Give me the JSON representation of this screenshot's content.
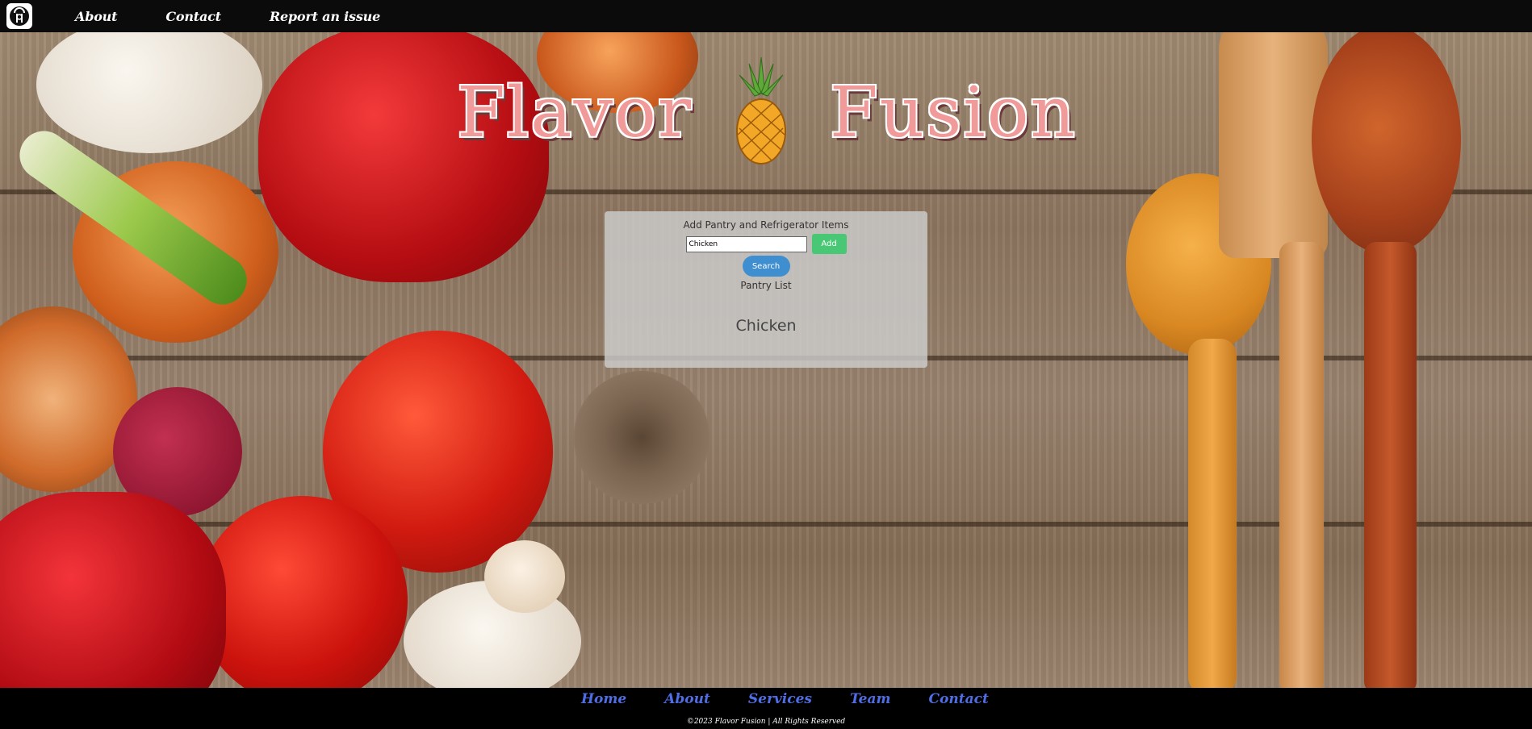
{
  "nav": {
    "logo_icon": "chef-hat-utensils-icon",
    "links": [
      "About",
      "Contact",
      "Report an issue"
    ]
  },
  "hero": {
    "title_left": "Flavor",
    "title_right": "Fusion",
    "title_icon": "pineapple-icon"
  },
  "pantry": {
    "heading": "Add Pantry and Refrigerator Items",
    "input_value": "Chicken",
    "add_label": "Add",
    "search_label": "Search",
    "list_label": "Pantry List",
    "items": [
      "Chicken"
    ]
  },
  "footer": {
    "links": [
      "Home",
      "About",
      "Services",
      "Team",
      "Contact"
    ],
    "copyright": "©2023 Flavor Fusion | All Rights Reserved"
  },
  "colors": {
    "nav_bg": "#0b0b0b",
    "title_pink": "#f19a9a",
    "add_green": "#48c774",
    "search_blue": "#3e8ed0",
    "footer_link_blue": "#4f6ee6"
  }
}
